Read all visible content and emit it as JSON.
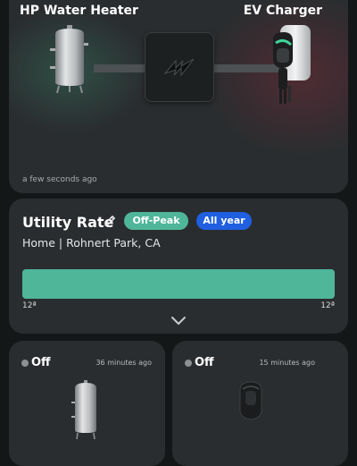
{
  "flow": {
    "heater_title": "HP Water Heater",
    "ev_title": "EV Charger",
    "timestamp": "a few seconds ago"
  },
  "rate": {
    "title": "Utility Rate",
    "badge_period": "Off-Peak",
    "badge_season": "All year",
    "location": "Home | Rohnert Park, CA",
    "tick_start": "12ª",
    "tick_end": "12ª",
    "offpeak_share": 1.0
  },
  "devices": [
    {
      "status": "Off",
      "time": "36 minutes ago",
      "icon": "water-heater-icon"
    },
    {
      "status": "Off",
      "time": "15 minutes ago",
      "icon": "ev-charger-icon"
    }
  ],
  "colors": {
    "offpeak": "#4fb69a",
    "allyear": "#1f5fe0",
    "card": "#2a2d2f",
    "background": "#141718"
  }
}
